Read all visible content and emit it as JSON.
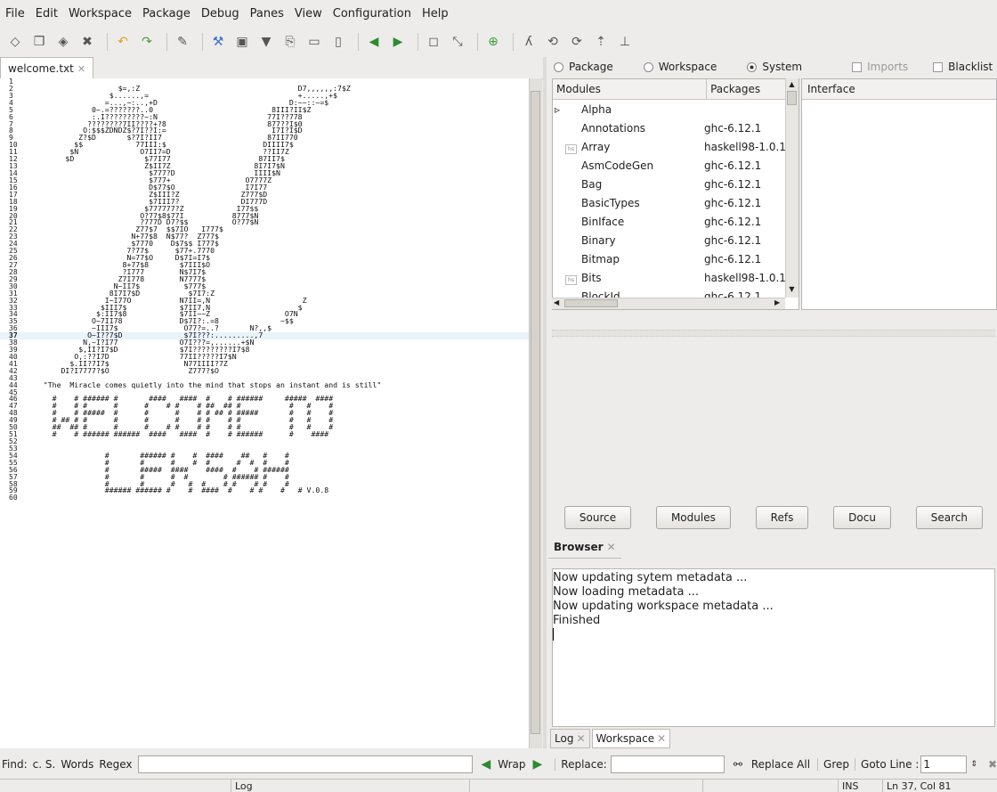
{
  "menu": [
    "File",
    "Edit",
    "Workspace",
    "Package",
    "Debug",
    "Panes",
    "View",
    "Configuration",
    "Help"
  ],
  "editor": {
    "tab_title": "welcome.txt",
    "line_numbers": [
      "1",
      "2",
      "3",
      "4",
      "5",
      "6",
      "7",
      "8",
      "9",
      "10",
      "11",
      "12",
      "13",
      "14",
      "15",
      "16",
      "17",
      "18",
      "19",
      "20",
      "21",
      "22",
      "23",
      "24",
      "25",
      "26",
      "27",
      "28",
      "29",
      "30",
      "31",
      "32",
      "33",
      "34",
      "35",
      "36",
      "37",
      "38",
      "39",
      "40",
      "41",
      "42",
      "43",
      "44",
      "45",
      "46",
      "47",
      "48",
      "49",
      "50",
      "51",
      "52",
      "53",
      "54",
      "55",
      "56",
      "57",
      "58",
      "59",
      "60"
    ],
    "current_line": 37,
    "lines": [
      "",
      "                    $=,:Z                                    D7,,,,,,:7$Z",
      "                  $......,=                                  +.....,+$",
      "                 =...,~:..,+D                              D:~~::~=$",
      "              0~.=???????..0                           8III?II$Z",
      "              :.I?????????~:N                         77I??778",
      "             ????????7II????+?8                       877??I$0",
      "            O:$$$ZDNDZ$?7I??I:=                        I7I?I$D",
      "           Z?$D       $?7I?II7                        87II770",
      "          $$            77III:$                      DIIII7$",
      "         $N              O7II7=D                     ??II7Z",
      "        $D                $77I77                    87II7$",
      "                          Z$II7Z                   8I7I7$N",
      "                           $777?D                  IIII$N",
      "                           $777+                 O7777Z",
      "                           D$77$O                I7I77",
      "                           Z$III?Z              Z777$D",
      "                           $7III7?              DI777D",
      "                          $777777?Z            I77$$",
      "                         O?77$8$77I           8777$N",
      "                         ?777D D7?$$          O?77$N",
      "                        Z77$7  $$7IO   I777$",
      "                       N+77$8  N$77?  Z777$",
      "                       $7770    D$7$$ I777$",
      "                      7?77$      $77+.7770",
      "                      N=77$O     D$7I=I7$",
      "                     8+77$8       $7III$O",
      "                     ?I777        N$7I7$",
      "                    Z7I778        N7777$",
      "                   N~II7$          $777$",
      "                  8I7I7$D           $7I7:Z",
      "                 I~I77O           N7II=,N                     Z",
      "                $III7$            $7II7,N                    $",
      "               $:II7$8            $7II~~Z                 O7N",
      "              O~7II78             D$7I?:.=8              ~$$",
      "              ~III7$               O77?=..?       N?,,$",
      "             O~I??7$D              $7I???:.........,7",
      "            N,~I?I77              O7I???=,......+$N",
      "           $,II?I7$D              $7I?????????I7$8",
      "          O,:??I7D                77II?????I7$N",
      "         $.II?7I7$                 N77IIII?7Z",
      "       DI?I7777?$O                  Z777?$O",
      "",
      "   \"The  Miracle comes quietly into the mind that stops an instant and is still\"",
      "",
      "     #    # ###### #       ####   ####  #    # ######     #####  ####",
      "     #    # #      #      #    # #    # ##  ## #           #   #    #",
      "     #    # #####  #      #      #    # # ## # #####       #   #    #",
      "     # ## # #      #      #      #    # #    # #           #   #    #",
      "     ##  ## #      #      #    # #    # #    # #           #   #    #",
      "     #    # ###### ######  ####   ####  #    # ######      #    ####",
      "",
      "",
      "                 #       ###### #    #  ####    ##   #    #",
      "                 #       #      #    #  #      #  #  #    #",
      "                 #       #####  ####    ####  #    # ######",
      "                 #       #      #  #        # ###### #    #",
      "                 #       #      #   #  #    # #    # #    #",
      "                 ###### ###### #    #  ####  #    # #    #   # V.0.8",
      ""
    ]
  },
  "browser": {
    "scope_radios": [
      {
        "label": "Package",
        "selected": false
      },
      {
        "label": "Workspace",
        "selected": false
      },
      {
        "label": "System",
        "selected": true
      }
    ],
    "checkboxes": [
      {
        "label": "Imports",
        "enabled": false
      },
      {
        "label": "Blacklist",
        "enabled": true
      }
    ],
    "modules_header": "Modules",
    "packages_header": "Packages",
    "interface_header": "Interface",
    "rows": [
      {
        "module": "Alpha",
        "package": "",
        "expander": true,
        "hs_icon": false
      },
      {
        "module": "Annotations",
        "package": "ghc-6.12.1",
        "expander": false,
        "hs_icon": false
      },
      {
        "module": "Array",
        "package": "haskell98-1.0.1",
        "expander": false,
        "hs_icon": true
      },
      {
        "module": "AsmCodeGen",
        "package": "ghc-6.12.1",
        "expander": false,
        "hs_icon": false
      },
      {
        "module": "Bag",
        "package": "ghc-6.12.1",
        "expander": false,
        "hs_icon": false
      },
      {
        "module": "BasicTypes",
        "package": "ghc-6.12.1",
        "expander": false,
        "hs_icon": false
      },
      {
        "module": "BinIface",
        "package": "ghc-6.12.1",
        "expander": false,
        "hs_icon": false
      },
      {
        "module": "Binary",
        "package": "ghc-6.12.1",
        "expander": false,
        "hs_icon": false
      },
      {
        "module": "Bitmap",
        "package": "ghc-6.12.1",
        "expander": false,
        "hs_icon": false
      },
      {
        "module": "Bits",
        "package": "haskell98-1.0.1",
        "expander": false,
        "hs_icon": true
      },
      {
        "module": "BlockId",
        "package": "ghc-6.12.1",
        "expander": false,
        "hs_icon": false
      }
    ],
    "buttons": [
      "Source",
      "Modules",
      "Refs",
      "Docu",
      "Search"
    ],
    "pane_tab": "Browser"
  },
  "log": {
    "lines": [
      "Now updating sytem metadata ...",
      "Now loading metadata ...",
      "Now updating workspace metadata ...",
      "Finished"
    ],
    "tabs": [
      "Log",
      "Workspace"
    ]
  },
  "findbar": {
    "find_label": "Find:",
    "options": [
      "c. S.",
      "Words",
      "Regex"
    ],
    "wrap_label": "Wrap",
    "replace_label": "Replace:",
    "replace_all_label": "Replace All",
    "grep_label": "Grep",
    "goto_label": "Goto Line :",
    "goto_value": "1"
  },
  "status": {
    "center": "Log",
    "mode": "INS",
    "position": "Ln  37, Col  81"
  },
  "colors": {
    "current_line": "#eaf2fb",
    "green_arrow": "#2f8a2f"
  }
}
